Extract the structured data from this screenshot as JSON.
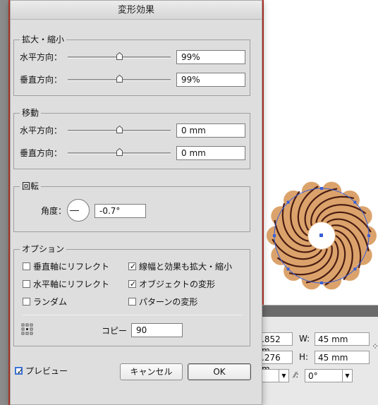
{
  "dialog": {
    "title": "変形効果",
    "scale": {
      "group_title": "拡大・縮小",
      "horizontal_label": "水平方向：",
      "horizontal_value": "99%",
      "horizontal_slider": 0.5,
      "vertical_label": "垂直方向：",
      "vertical_value": "99%",
      "vertical_slider": 0.5
    },
    "move": {
      "group_title": "移動",
      "horizontal_label": "水平方向：",
      "horizontal_value": "0 mm",
      "horizontal_slider": 0.5,
      "vertical_label": "垂直方向：",
      "vertical_value": "0 mm",
      "vertical_slider": 0.5
    },
    "rotate": {
      "group_title": "回転",
      "angle_label": "角度：",
      "angle_value": "-0.7°"
    },
    "options": {
      "group_title": "オプション",
      "reflect_x_label": "垂直軸にリフレクト",
      "reflect_x_checked": false,
      "reflect_y_label": "水平軸にリフレクト",
      "reflect_y_checked": false,
      "random_label": "ランダム",
      "random_checked": false,
      "scale_strokes_label": "線幅と効果も拡大・縮小",
      "scale_strokes_checked": true,
      "transform_objects_label": "オブジェクトの変形",
      "transform_objects_checked": true,
      "transform_patterns_label": "パターンの変形",
      "transform_patterns_checked": false,
      "copies_label": "コピー",
      "copies_value": "90",
      "reference_point_icon": "reference-point-grid-icon"
    },
    "preview_label": "プレビュー",
    "preview_checked": true,
    "cancel_label": "キャンセル",
    "ok_label": "OK"
  },
  "transform_panel": {
    "x_value": ".852 m",
    "y_value": ".276 m",
    "w_label": "W:",
    "w_value": "45 mm",
    "h_label": "H:",
    "h_value": "45 mm",
    "shear_icon": "shear-icon",
    "shear_value": "0°"
  },
  "colors": {
    "artwork_fill": "#dba36b",
    "artwork_stroke": "#4a1c12",
    "selection": "#3a5fd8",
    "guide": "#c0392b"
  }
}
